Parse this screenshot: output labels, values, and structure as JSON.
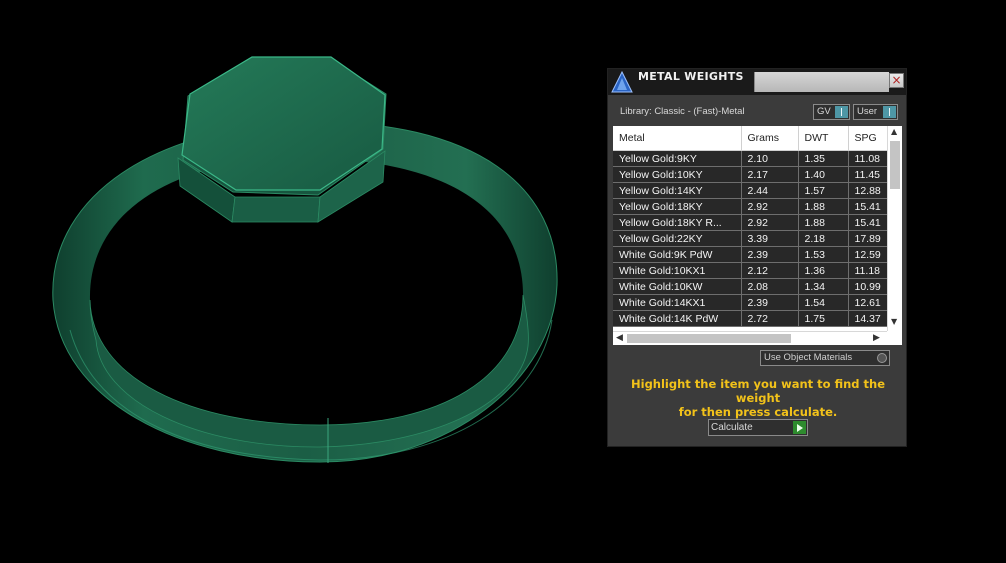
{
  "panel": {
    "title": "METAL WEIGHTS",
    "close_glyph": "×",
    "logo_icon": "app-logo-icon",
    "library_label": "Library: Classic - (Fast)-Metal",
    "toggles": {
      "gv": "GV",
      "user": "User"
    },
    "use_object_materials": "Use Object Materials",
    "instruction": "Highlight the item you want to find the weight\nfor then press calculate.",
    "calculate_label": "Calculate"
  },
  "table": {
    "headers": [
      "Metal",
      "Grams",
      "DWT",
      "SPG"
    ],
    "rows": [
      [
        "Yellow Gold:9KY",
        "2.10",
        "1.35",
        "11.08"
      ],
      [
        "Yellow Gold:10KY",
        "2.17",
        "1.40",
        "11.45"
      ],
      [
        "Yellow Gold:14KY",
        "2.44",
        "1.57",
        "12.88"
      ],
      [
        "Yellow Gold:18KY",
        "2.92",
        "1.88",
        "15.41"
      ],
      [
        "Yellow Gold:18KY R...",
        "2.92",
        "1.88",
        "15.41"
      ],
      [
        "Yellow Gold:22KY",
        "3.39",
        "2.18",
        "17.89"
      ],
      [
        "White Gold:9K PdW",
        "2.39",
        "1.53",
        "12.59"
      ],
      [
        "White Gold:10KX1",
        "2.12",
        "1.36",
        "11.18"
      ],
      [
        "White Gold:10KW",
        "2.08",
        "1.34",
        "10.99"
      ],
      [
        "White Gold:14KX1",
        "2.39",
        "1.54",
        "12.61"
      ],
      [
        "White Gold:14K PdW",
        "2.72",
        "1.75",
        "14.37"
      ]
    ]
  },
  "colors": {
    "ring_green": "#1b5e45",
    "panel_bg": "#3b3b3b",
    "instruction_yellow": "#f2c21a",
    "toggle_teal": "#4e97a6",
    "play_green": "#2e8b2e"
  }
}
